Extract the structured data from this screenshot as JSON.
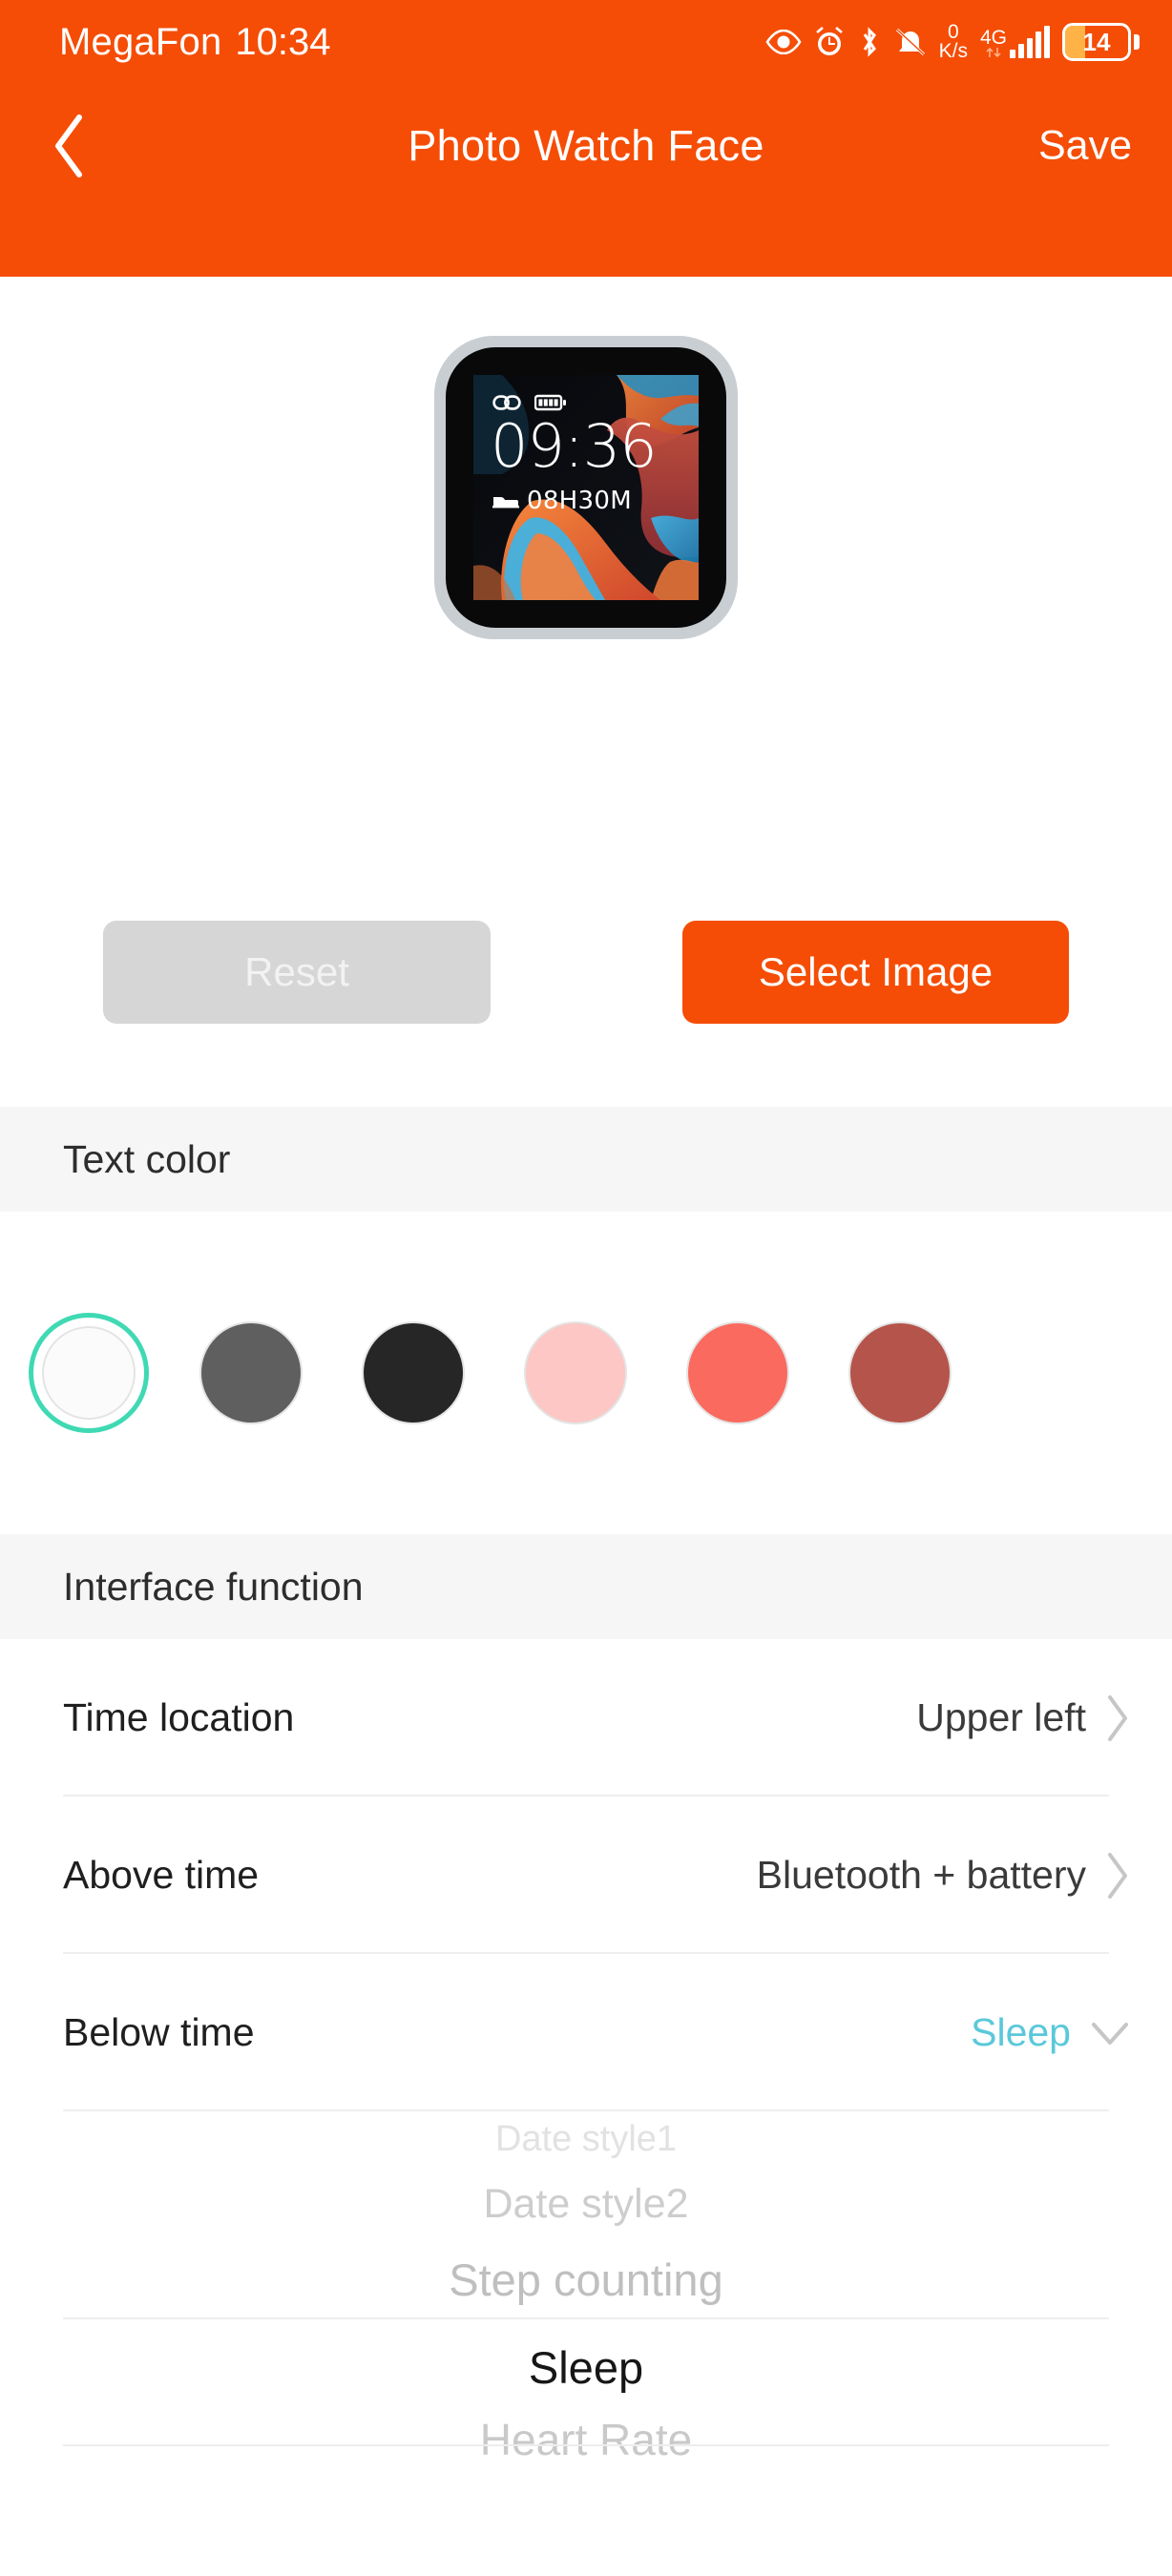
{
  "status_bar": {
    "carrier": "MegaFon",
    "clock": "10:34",
    "network_speed_value": "0",
    "network_speed_unit": "K/s",
    "network_generation": "4G",
    "network_generation_sup": "+",
    "battery_level": "14",
    "icons": [
      "eye-icon",
      "alarm-icon",
      "bluetooth-icon",
      "bell-muted-icon",
      "signal-bars-icon",
      "battery-icon"
    ]
  },
  "nav": {
    "back_icon": "chevron-left-icon",
    "title": "Photo Watch Face",
    "save_label": "Save"
  },
  "preview": {
    "watch_time": "09:36",
    "watch_sleep_value": "08H30M",
    "watch_icons": [
      "bluetooth-link-icon",
      "battery-icon",
      "bed-icon"
    ]
  },
  "actions": {
    "reset_label": "Reset",
    "select_image_label": "Select Image"
  },
  "text_color": {
    "header": "Text color",
    "selected_index": 0,
    "selection_ring_color": "#3fd9b4",
    "swatches": [
      {
        "name": "white",
        "hex": "#fbfbfb"
      },
      {
        "name": "gray",
        "hex": "#5f5f5f"
      },
      {
        "name": "black",
        "hex": "#262626"
      },
      {
        "name": "light-pink",
        "hex": "#fcc7c4"
      },
      {
        "name": "coral",
        "hex": "#fb6a5f"
      },
      {
        "name": "brick-red",
        "hex": "#b5544a"
      }
    ]
  },
  "interface_function": {
    "header": "Interface function",
    "rows": [
      {
        "label": "Time location",
        "value": "Upper left",
        "chevron": "chevron-right-icon",
        "accent": false
      },
      {
        "label": "Above time",
        "value": "Bluetooth + battery",
        "chevron": "chevron-right-icon",
        "accent": false
      },
      {
        "label": "Below time",
        "value": "Sleep",
        "chevron": "chevron-down-icon",
        "accent": true
      }
    ]
  },
  "below_time_picker": {
    "selected": "Sleep",
    "options": [
      "Date style1",
      "Date style2",
      "Step counting",
      "Sleep",
      "Heart Rate"
    ]
  },
  "colors": {
    "brand_orange": "#f54d06",
    "accent_teal": "#5bc8da",
    "section_bg": "#f6f6f6"
  }
}
